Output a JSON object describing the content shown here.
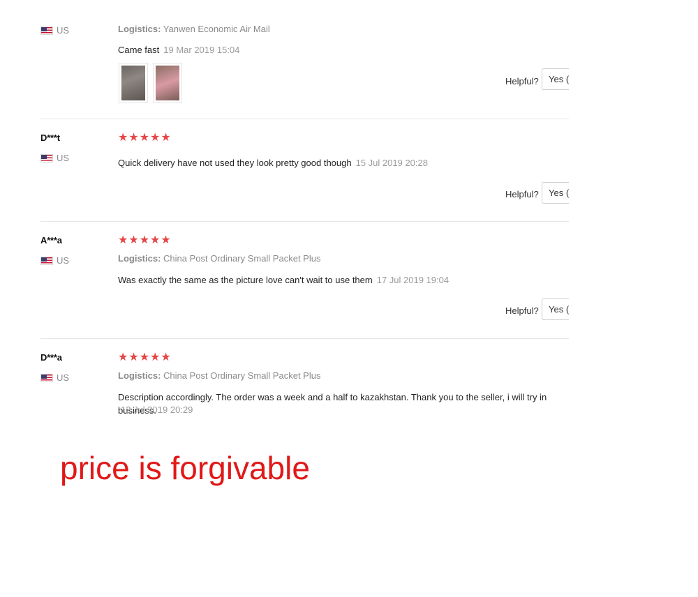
{
  "reviews": [
    {
      "user": "",
      "country": "US",
      "logistics_label": "Logistics:",
      "logistics_value": "Yanwen Economic Air Mail",
      "text": "Came fast",
      "date": "19 Mar 2019 15:04",
      "photos": [
        "photo-thumbnail",
        "photo-thumbnail"
      ],
      "helpful_label": "Helpful?",
      "yes_label": "Yes (("
    },
    {
      "user": "D***t",
      "country": "US",
      "stars": "★★★★★",
      "text": "Quick delivery have not used they look pretty good though",
      "date": "15 Jul 2019 20:28",
      "helpful_label": "Helpful?",
      "yes_label": "Yes (("
    },
    {
      "user": "A***a",
      "country": "US",
      "stars": "★★★★★",
      "logistics_label": "Logistics:",
      "logistics_value": "China Post Ordinary Small Packet Plus",
      "text": "Was exactly the same as the picture love can't wait to use them",
      "date": "17 Jul 2019 19:04",
      "helpful_label": "Helpful?",
      "yes_label": "Yes (("
    },
    {
      "user": "D***a",
      "country": "US",
      "stars": "★★★★★",
      "logistics_label": "Logistics:",
      "logistics_value": "China Post Ordinary Small Packet Plus",
      "text": "Description accordingly. The order was a week and a half to kazakhstan. Thank you to the seller, i will try in business.",
      "date": "12 Jul 2019 20:29"
    }
  ],
  "overlay_note": "price is forgivable",
  "colors": {
    "stars": "#e64545",
    "overlay_text": "#e01818",
    "muted_text": "#8a8a8a"
  },
  "icons": {
    "flag": "us-flag-icon",
    "star": "star-icon"
  }
}
